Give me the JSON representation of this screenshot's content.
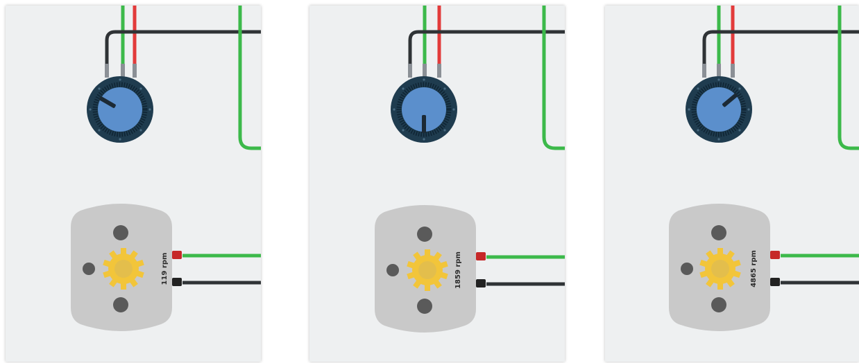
{
  "colors": {
    "panel_bg": "#eef0f1",
    "wire_green": "#3cb94a",
    "wire_red": "#e23b3b",
    "wire_black": "#2f3336",
    "pot_ring": "#1f3c4f",
    "pot_knob": "#5b8fcc",
    "motor_body": "#c9c9c9",
    "gear": "#f2c53a"
  },
  "panels": [
    {
      "rpm_label": "119 rpm",
      "knob_angle_deg": -60
    },
    {
      "rpm_label": "1859 rpm",
      "knob_angle_deg": 180
    },
    {
      "rpm_label": "4865 rpm",
      "knob_angle_deg": 50
    }
  ]
}
